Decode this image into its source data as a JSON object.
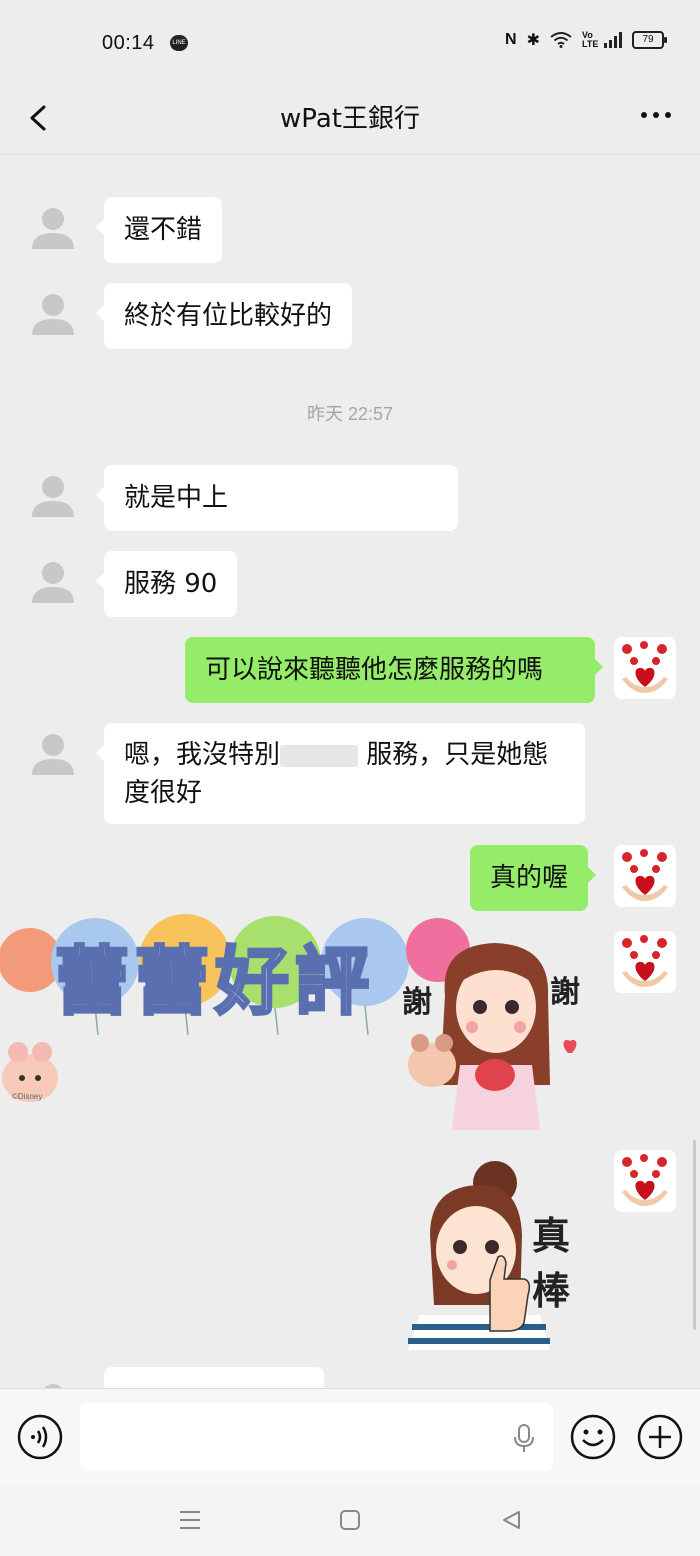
{
  "status_bar": {
    "time": "00:14",
    "line_badge": "LINE",
    "volte": "Vo\nLTE",
    "battery": "79"
  },
  "header": {
    "title": "wPat王銀行"
  },
  "messages": {
    "m1": "還不錯",
    "m2": "終於有位比較好的",
    "time_sep": "昨天 22:57",
    "m3": "就是中上",
    "m4": "服務 90",
    "m5": "可以說來聽聽他怎麼服務的嗎",
    "m6_line1": "嗯，我沒特別",
    "m6_line1_tail": " 服務，只是她態",
    "m6_line2": "度很好",
    "m7": "真的喔"
  },
  "stickers": {
    "praise_text": "蕾蕾好評",
    "thanks_left": "謝",
    "thanks_right": "謝",
    "disney": "©Disney",
    "great_top": "真",
    "great_bottom": "棒"
  },
  "colors": {
    "chat_bg": "#ededed",
    "bubble_out": "#95ec69",
    "bubble_in": "#ffffff"
  }
}
